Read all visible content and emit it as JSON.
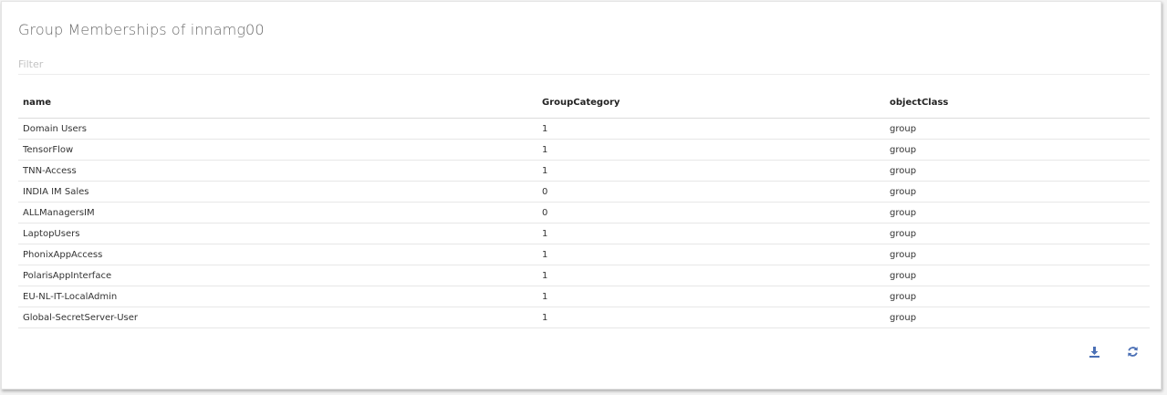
{
  "panel": {
    "title": "Group Memberships of innamg00",
    "filter_placeholder": "Filter",
    "filter_value": ""
  },
  "table": {
    "columns": [
      "name",
      "GroupCategory",
      "objectClass"
    ],
    "rows": [
      {
        "name": "Domain Users",
        "GroupCategory": "1",
        "objectClass": "group"
      },
      {
        "name": "TensorFlow",
        "GroupCategory": "1",
        "objectClass": "group"
      },
      {
        "name": "TNN-Access",
        "GroupCategory": "1",
        "objectClass": "group"
      },
      {
        "name": "INDIA IM Sales",
        "GroupCategory": "0",
        "objectClass": "group"
      },
      {
        "name": "ALLManagersIM",
        "GroupCategory": "0",
        "objectClass": "group"
      },
      {
        "name": "LaptopUsers",
        "GroupCategory": "1",
        "objectClass": "group"
      },
      {
        "name": "PhonixAppAccess",
        "GroupCategory": "1",
        "objectClass": "group"
      },
      {
        "name": "PolarisAppInterface",
        "GroupCategory": "1",
        "objectClass": "group"
      },
      {
        "name": "EU-NL-IT-LocalAdmin",
        "GroupCategory": "1",
        "objectClass": "group"
      },
      {
        "name": "Global-SecretServer-User",
        "GroupCategory": "1",
        "objectClass": "group"
      }
    ]
  },
  "actions": {
    "download_icon": "download-icon",
    "refresh_icon": "refresh-icon",
    "icon_color": "#4a6fb5"
  }
}
